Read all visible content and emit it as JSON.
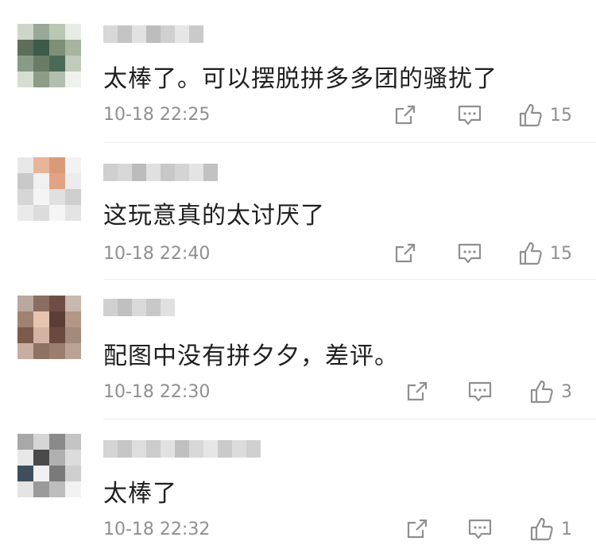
{
  "comments": [
    {
      "text": "太棒了。可以摆脱拼多多团的骚扰了",
      "time": "10-18 22:25",
      "likes": "15",
      "avatar_colors": [
        "#cdd6c8",
        "#9aa89a",
        "#b9c7b4",
        "#e8ece6",
        "#5e6e5a",
        "#3d5a4a",
        "#7d8f74",
        "#a8b59e",
        "#8a9a88",
        "#6a7c66",
        "#4a6a57",
        "#c0cbbb",
        "#d6ddd2",
        "#8c9c86",
        "#b3bfae",
        "#eef1ec"
      ],
      "username_colors": [
        "#d8d8d8",
        "#c4c4c4",
        "#e2e2e2",
        "#bdbdbd",
        "#d0d0d0",
        "#e6e6e6",
        "#cacaca"
      ]
    },
    {
      "text": "这玩意真的太讨厌了",
      "time": "10-18 22:40",
      "likes": "15",
      "avatar_colors": [
        "#e8e8e8",
        "#e6b59b",
        "#d99a78",
        "#f2f2f2",
        "#c9c9c9",
        "#f0f0f0",
        "#e2a384",
        "#ececec",
        "#d6d6d6",
        "#f4f4f4",
        "#e0e0e0",
        "#cfcfcf",
        "#eaeaea",
        "#dcdcdc",
        "#f5f5f5",
        "#e4e4e4"
      ],
      "username_colors": [
        "#cfcfcf",
        "#d8d8d8",
        "#bcbcbc",
        "#e0e0e0",
        "#c8c8c8",
        "#d4d4d4",
        "#e4e4e4",
        "#c2c2c2"
      ]
    },
    {
      "text": "配图中没有拼夕夕，差评。",
      "time": "10-18 22:30",
      "likes": "3",
      "avatar_colors": [
        "#b8a8a0",
        "#8a6e62",
        "#6e4e44",
        "#c9b8ae",
        "#a08272",
        "#e6c4b0",
        "#5a3e36",
        "#b49684",
        "#7c5a4c",
        "#d2b4a2",
        "#6a4a3e",
        "#a48a7c",
        "#c6aea0",
        "#8e7264",
        "#9c7e6e",
        "#bca294"
      ],
      "username_colors": [
        "#d0d0d0",
        "#c0c0c0",
        "#dadada",
        "#c8c8c8",
        "#e0e0e0"
      ]
    },
    {
      "text": "太棒了",
      "time": "10-18 22:32",
      "likes": "1",
      "avatar_colors": [
        "#a8a8a8",
        "#d6d6d6",
        "#8a8a8a",
        "#c4c4c4",
        "#e8e8e8",
        "#4a4a4a",
        "#b0b0b0",
        "#dcdcdc",
        "#3e4e5e",
        "#f0f0f0",
        "#7a7a7a",
        "#cfcfcf",
        "#e4e4e4",
        "#9a9a9a",
        "#bdbdbd",
        "#f2f2f2"
      ],
      "username_colors": [
        "#d4d4d4",
        "#c6c6c6",
        "#dedede",
        "#cccccc",
        "#e2e2e2",
        "#c0c0c0",
        "#d8d8d8",
        "#e6e6e6",
        "#cacaca",
        "#dcdcdc",
        "#d0d0d0"
      ]
    }
  ]
}
